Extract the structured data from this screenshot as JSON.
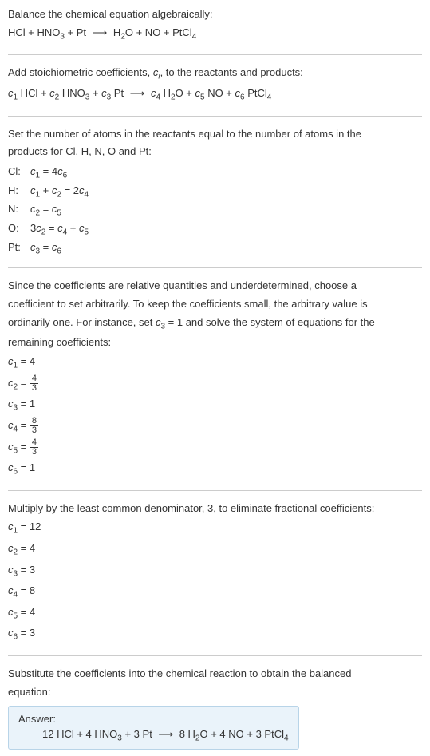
{
  "section1": {
    "title": "Balance the chemical equation algebraically:",
    "equation_parts": {
      "lhs1": "HCl + HNO",
      "lhs1_sub": "3",
      "lhs2": " + Pt",
      "arrow": " ⟶ ",
      "rhs1": "H",
      "rhs1_sub": "2",
      "rhs2": "O + NO + PtCl",
      "rhs2_sub": "4"
    }
  },
  "section2": {
    "title_pre": "Add stoichiometric coefficients, ",
    "ci": "c",
    "ci_sub": "i",
    "title_post": ", to the reactants and products:",
    "eq": {
      "c1": "c",
      "s1": "1",
      "t1": " HCl + ",
      "c2": "c",
      "s2": "2",
      "t2": " HNO",
      "sub2": "3",
      "t2b": " + ",
      "c3": "c",
      "s3": "3",
      "t3": " Pt",
      "arrow": " ⟶ ",
      "c4": "c",
      "s4": "4",
      "t4": " H",
      "sub4": "2",
      "t4b": "O + ",
      "c5": "c",
      "s5": "5",
      "t5": " NO + ",
      "c6": "c",
      "s6": "6",
      "t6": " PtCl",
      "sub6": "4"
    }
  },
  "section3": {
    "title1": "Set the number of atoms in the reactants equal to the number of atoms in the",
    "title2": "products for Cl, H, N, O and Pt:",
    "rows": [
      {
        "label": "Cl:",
        "lhs_c": "c",
        "lhs_s": "1",
        "eq": " = 4",
        "rhs_c": "c",
        "rhs_s": "6",
        "extra": ""
      },
      {
        "label": "H:",
        "full": "c₁ + c₂ = 2c₄"
      },
      {
        "label": "N:",
        "full": "c₂ = c₅"
      },
      {
        "label": "O:",
        "full": "3c₂ = c₄ + c₅"
      },
      {
        "label": "Pt:",
        "full": "c₃ = c₆"
      }
    ],
    "cl_text": {
      "c1": "c",
      "s1": "1",
      "eq": " = 4",
      "c6": "c",
      "s6": "6"
    },
    "h_text": {
      "c1": "c",
      "s1": "1",
      "plus": " + ",
      "c2": "c",
      "s2": "2",
      "eq": " = 2",
      "c4": "c",
      "s4": "4"
    },
    "n_text": {
      "c2": "c",
      "s2": "2",
      "eq": " = ",
      "c5": "c",
      "s5": "5"
    },
    "o_text": {
      "three": "3",
      "c2": "c",
      "s2": "2",
      "eq": " = ",
      "c4": "c",
      "s4": "4",
      "plus": " + ",
      "c5": "c",
      "s5": "5"
    },
    "pt_text": {
      "c3": "c",
      "s3": "3",
      "eq": " = ",
      "c6": "c",
      "s6": "6"
    },
    "labels": {
      "cl": "Cl:",
      "h": "H:",
      "n": "N:",
      "o": "O:",
      "pt": "Pt:"
    }
  },
  "section4": {
    "line1": "Since the coefficients are relative quantities and underdetermined, choose a",
    "line2": "coefficient to set arbitrarily. To keep the coefficients small, the arbitrary value is",
    "line3_pre": "ordinarily one. For instance, set ",
    "line3_c": "c",
    "line3_s": "3",
    "line3_eq": " = 1",
    "line3_post": " and solve the system of equations for the",
    "line4": "remaining coefficients:",
    "coeffs": {
      "c1": {
        "c": "c",
        "s": "1",
        "eq": " = 4"
      },
      "c2": {
        "c": "c",
        "s": "2",
        "eq": " = ",
        "num": "4",
        "den": "3"
      },
      "c3": {
        "c": "c",
        "s": "3",
        "eq": " = 1"
      },
      "c4": {
        "c": "c",
        "s": "4",
        "eq": " = ",
        "num": "8",
        "den": "3"
      },
      "c5": {
        "c": "c",
        "s": "5",
        "eq": " = ",
        "num": "4",
        "den": "3"
      },
      "c6": {
        "c": "c",
        "s": "6",
        "eq": " = 1"
      }
    }
  },
  "section5": {
    "title": "Multiply by the least common denominator, 3, to eliminate fractional coefficients:",
    "coeffs": {
      "c1": {
        "c": "c",
        "s": "1",
        "eq": " = 12"
      },
      "c2": {
        "c": "c",
        "s": "2",
        "eq": " = 4"
      },
      "c3": {
        "c": "c",
        "s": "3",
        "eq": " = 3"
      },
      "c4": {
        "c": "c",
        "s": "4",
        "eq": " = 8"
      },
      "c5": {
        "c": "c",
        "s": "5",
        "eq": " = 4"
      },
      "c6": {
        "c": "c",
        "s": "6",
        "eq": " = 3"
      }
    }
  },
  "section6": {
    "line1": "Substitute the coefficients into the chemical reaction to obtain the balanced",
    "line2": "equation:",
    "answer_label": "Answer:",
    "eq": {
      "p1": "12 HCl + 4 HNO",
      "sub1": "3",
      "p2": " + 3 Pt",
      "arrow": " ⟶ ",
      "p3": "8 H",
      "sub3": "2",
      "p4": "O + 4 NO + 3 PtCl",
      "sub4": "4"
    }
  }
}
